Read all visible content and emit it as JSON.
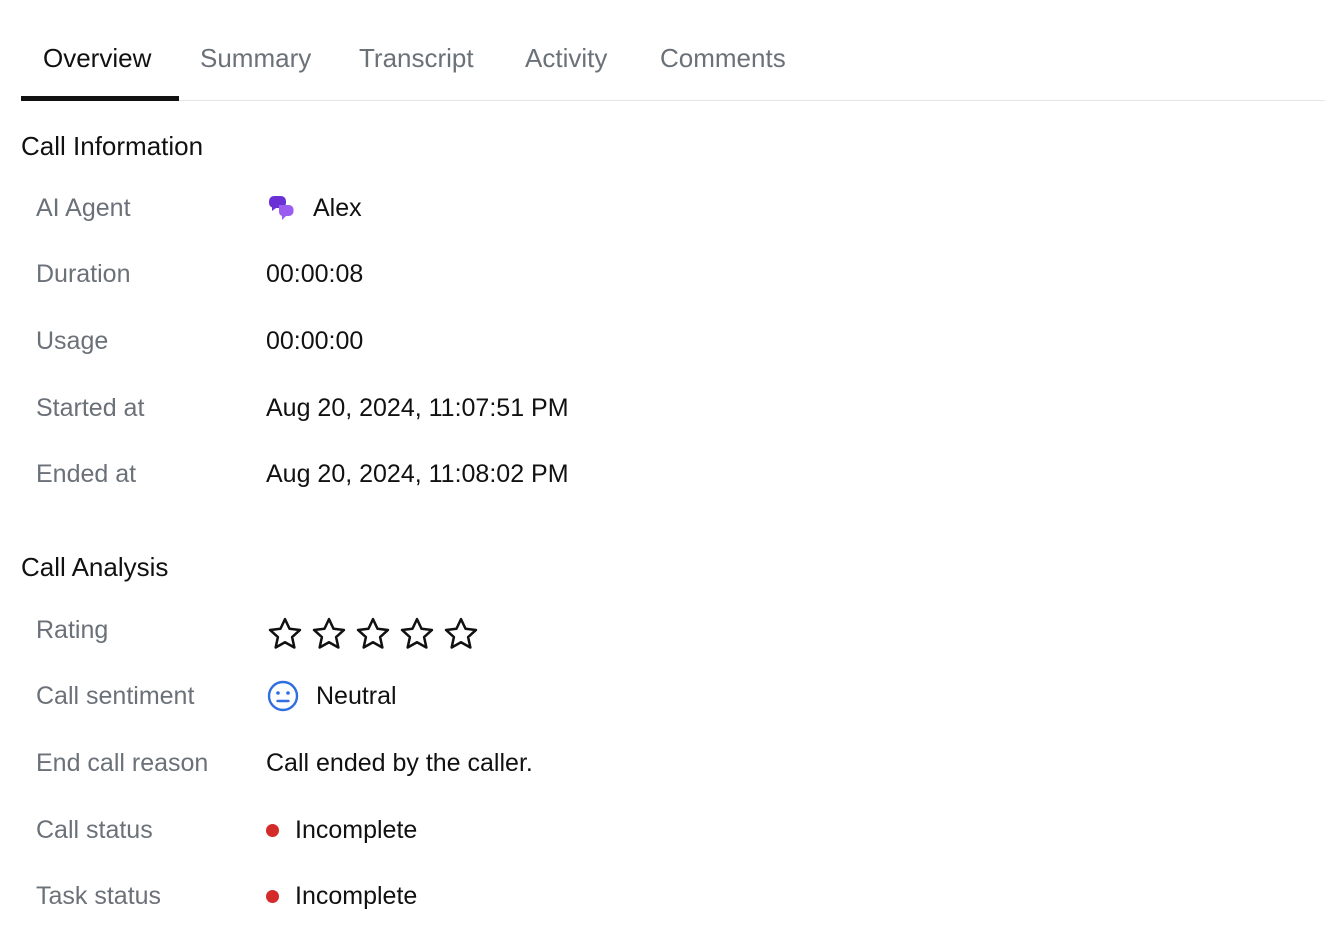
{
  "tabs": [
    {
      "label": "Overview",
      "active": true
    },
    {
      "label": "Summary",
      "active": false
    },
    {
      "label": "Transcript",
      "active": false
    },
    {
      "label": "Activity",
      "active": false
    },
    {
      "label": "Comments",
      "active": false
    }
  ],
  "call_information": {
    "title": "Call Information",
    "ai_agent": {
      "label": "AI Agent",
      "value": "Alex",
      "icon": "chat-bubbles-icon"
    },
    "duration": {
      "label": "Duration",
      "value": "00:00:08"
    },
    "usage": {
      "label": "Usage",
      "value": "00:00:00"
    },
    "started_at": {
      "label": "Started at",
      "value": "Aug 20, 2024, 11:07:51 PM"
    },
    "ended_at": {
      "label": "Ended at",
      "value": "Aug 20, 2024, 11:08:02 PM"
    }
  },
  "call_analysis": {
    "title": "Call Analysis",
    "rating": {
      "label": "Rating",
      "value": 0,
      "max": 5
    },
    "call_sentiment": {
      "label": "Call sentiment",
      "value": "Neutral",
      "icon": "neutral-face-icon"
    },
    "end_call_reason": {
      "label": "End call reason",
      "value": "Call ended by the caller."
    },
    "call_status": {
      "label": "Call status",
      "value": "Incomplete"
    },
    "task_status": {
      "label": "Task status",
      "value": "Incomplete"
    }
  },
  "colors": {
    "agent_icon": "#6b2fd6",
    "sentiment_icon": "#2f6fe0",
    "status_incomplete": "#d42a2a",
    "tab_active": "#111111",
    "tab_inactive": "#6b7178",
    "label_text": "#6b7178"
  }
}
